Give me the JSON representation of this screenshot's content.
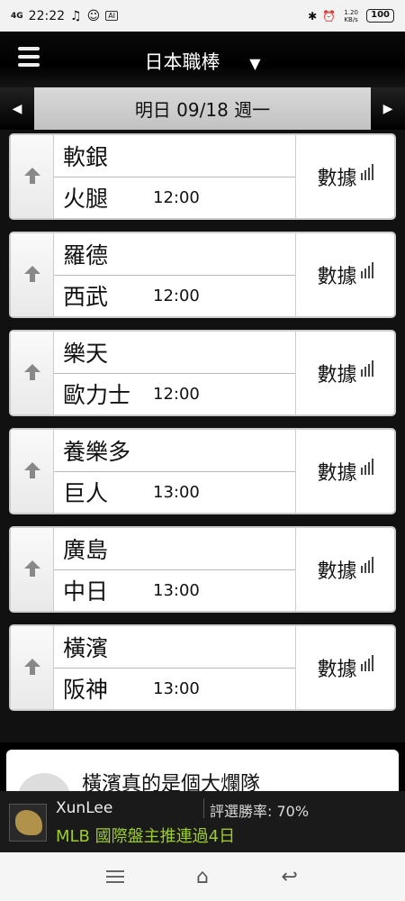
{
  "status": {
    "time": "22:22",
    "network": "4G",
    "speed": "1.20 KB/s",
    "battery": "100",
    "app_badge": "AI"
  },
  "header": {
    "title": "日本職棒",
    "dropdown_glyph": "▼"
  },
  "date_bar": {
    "label": "明日 09/18 週一",
    "prev_glyph": "◀",
    "next_glyph": "▶"
  },
  "games": [
    {
      "home": "軟銀",
      "away": "火腿",
      "time": "12:00",
      "data_label": "數據"
    },
    {
      "home": "羅德",
      "away": "西武",
      "time": "12:00",
      "data_label": "數據"
    },
    {
      "home": "樂天",
      "away": "歐力士",
      "time": "12:00",
      "data_label": "數據"
    },
    {
      "home": "養樂多",
      "away": "巨人",
      "time": "13:00",
      "data_label": "數據"
    },
    {
      "home": "廣島",
      "away": "中日",
      "time": "13:00",
      "data_label": "數據"
    },
    {
      "home": "橫濱",
      "away": "阪神",
      "time": "13:00",
      "data_label": "數據"
    }
  ],
  "article": {
    "title": "橫濱真的是個大爛隊"
  },
  "ad": {
    "name": "XunLee",
    "rate": "評選勝率: 70%",
    "promo": "MLB 國際盤主推連過4日"
  },
  "colors": {
    "promo": "#9ccd2a",
    "header_bg": "#000000"
  }
}
